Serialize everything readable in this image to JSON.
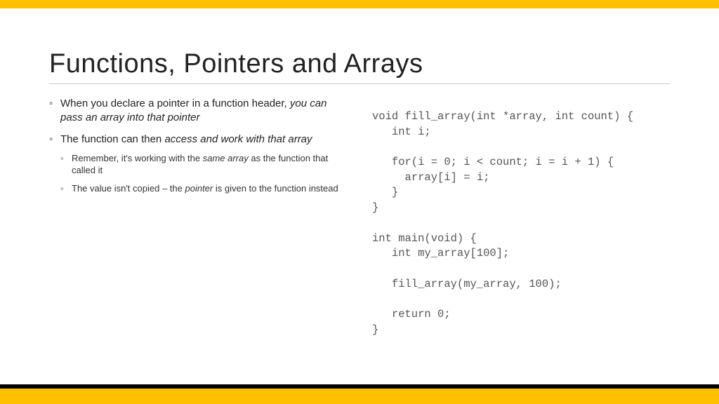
{
  "title": "Functions, Pointers and Arrays",
  "bullets": {
    "b1_plain": "When you declare a pointer in a function header, ",
    "b1_ital": "you can pass an array into that pointer",
    "b2_plain": "The function can then ",
    "b2_ital": "access and work with that array",
    "sub1_a": "Remember, it's working with the ",
    "sub1_ital": "same array",
    "sub1_b": " as the function that called it",
    "sub2_a": "The value isn't copied – the ",
    "sub2_ital": "pointer",
    "sub2_b": " is given to the function instead"
  },
  "code": "void fill_array(int *array, int count) {\n   int i;\n\n   for(i = 0; i < count; i = i + 1) {\n     array[i] = i;\n   }\n}\n\nint main(void) {\n   int my_array[100];\n\n   fill_array(my_array, 100);\n\n   return 0;\n}"
}
